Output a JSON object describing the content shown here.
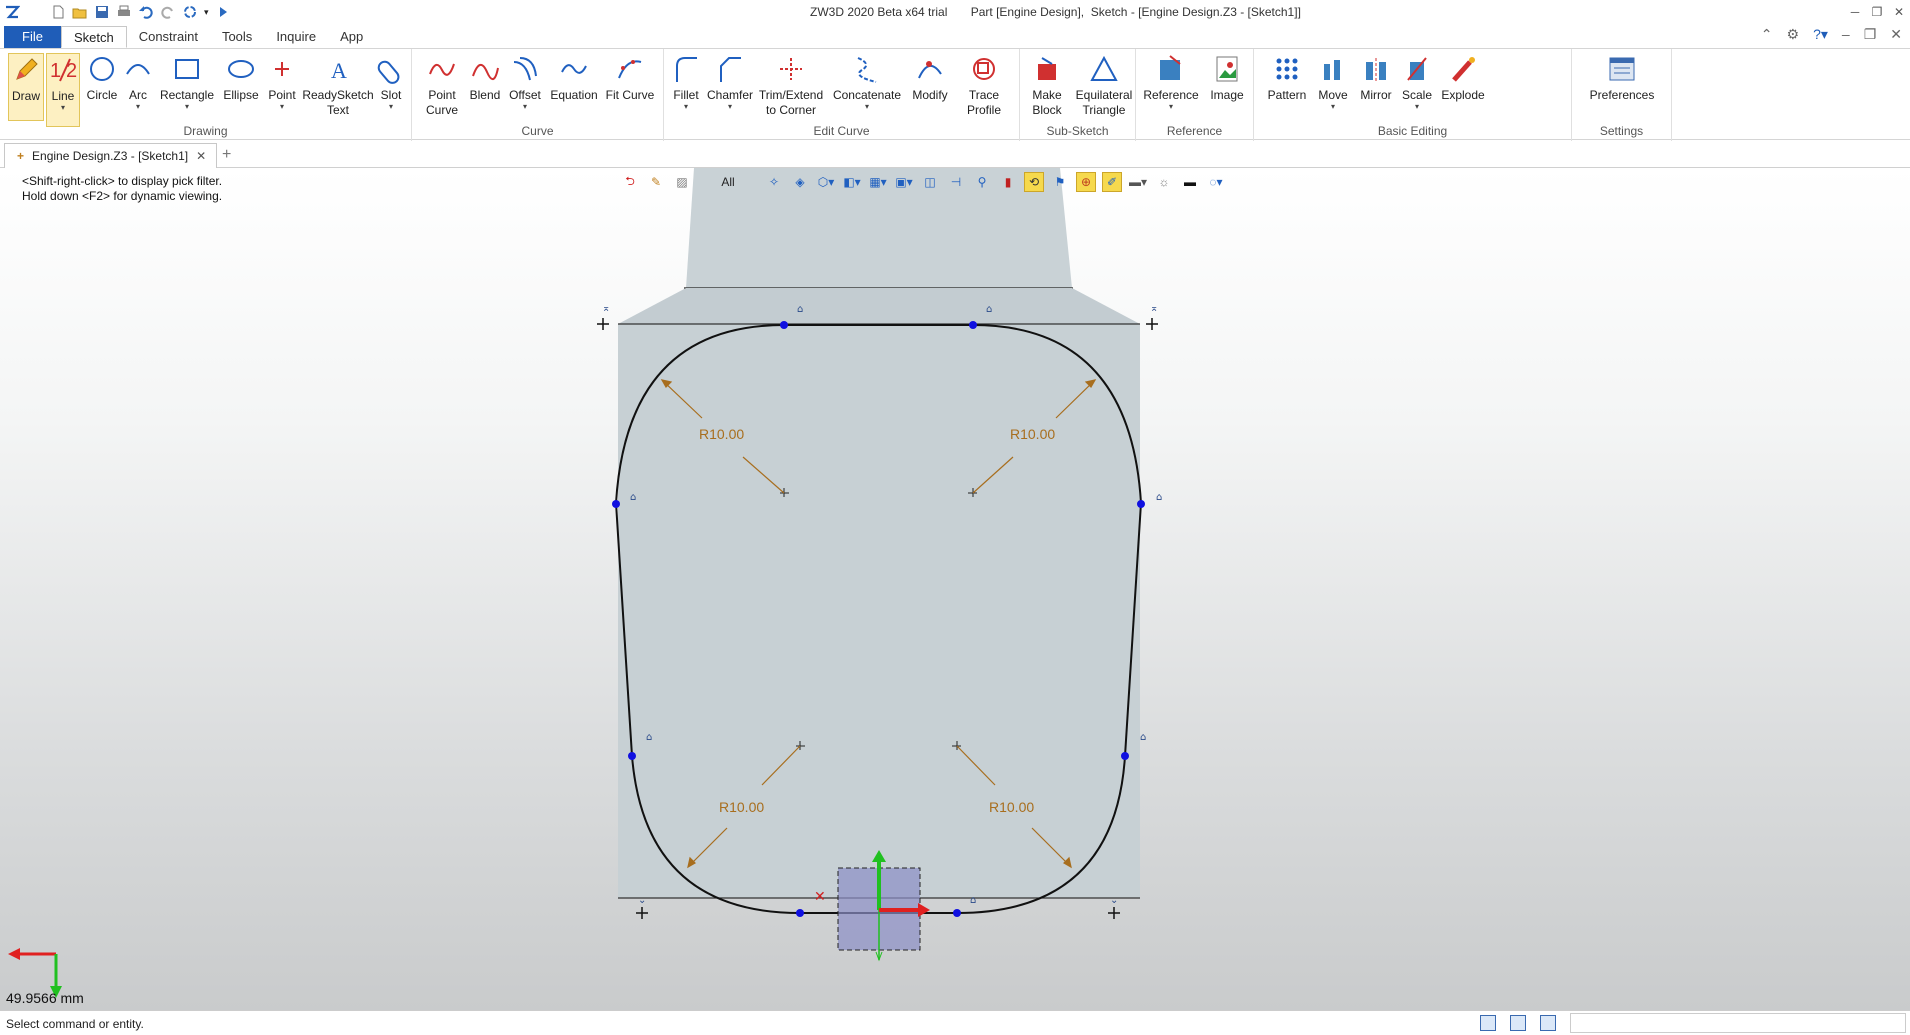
{
  "window": {
    "title": "ZW3D 2020 Beta x64 trial       Part [Engine Design],  Sketch - [Engine Design.Z3 - [Sketch1]]"
  },
  "menu": {
    "tabs": [
      "File",
      "Sketch",
      "Constraint",
      "Tools",
      "Inquire",
      "App"
    ],
    "active": "Sketch"
  },
  "ribbon": {
    "groups": {
      "drawing": "Drawing",
      "curve": "Curve",
      "edit_curve": "Edit Curve",
      "sub_sketch": "Sub-Sketch",
      "reference": "Reference",
      "basic_editing": "Basic Editing",
      "settings": "Settings"
    },
    "buttons": {
      "draw": "Draw",
      "line": "Line",
      "circle": "Circle",
      "arc": "Arc",
      "rectangle": "Rectangle",
      "ellipse": "Ellipse",
      "point": "Point",
      "readysketch_text_1": "ReadySketch",
      "readysketch_text_2": "Text",
      "slot": "Slot",
      "point_curve_1": "Point",
      "point_curve_2": "Curve",
      "blend": "Blend",
      "offset": "Offset",
      "equation": "Equation",
      "fit_curve": "Fit Curve",
      "fillet": "Fillet",
      "chamfer": "Chamfer",
      "trim_1": "Trim/Extend",
      "trim_2": "to Corner",
      "concatenate": "Concatenate",
      "modify": "Modify",
      "trace_1": "Trace",
      "trace_2": "Profile",
      "make_block_1": "Make",
      "make_block_2": "Block",
      "equilateral_1": "Equilateral",
      "equilateral_2": "Triangle",
      "reference": "Reference",
      "image": "Image",
      "pattern": "Pattern",
      "move": "Move",
      "mirror": "Mirror",
      "scale": "Scale",
      "explode": "Explode",
      "preferences": "Preferences"
    }
  },
  "document_tab": {
    "label": "Engine Design.Z3 - [Sketch1]"
  },
  "viewport": {
    "hint_line1": "<Shift-right-click> to display pick filter.",
    "hint_line2": "Hold down <F2> for dynamic viewing.",
    "filter": "All",
    "dimensions": [
      "R10.00",
      "R10.00",
      "R10.00",
      "R10.00"
    ],
    "scale": "49.9566 mm",
    "colors": {
      "dimension": "#a86e1e",
      "sketch_point": "#1010e0",
      "part_fill": "#c7d0d4",
      "x_axis": "#e02020",
      "y_axis": "#20c020"
    }
  },
  "status": {
    "text": "Select command or entity."
  }
}
